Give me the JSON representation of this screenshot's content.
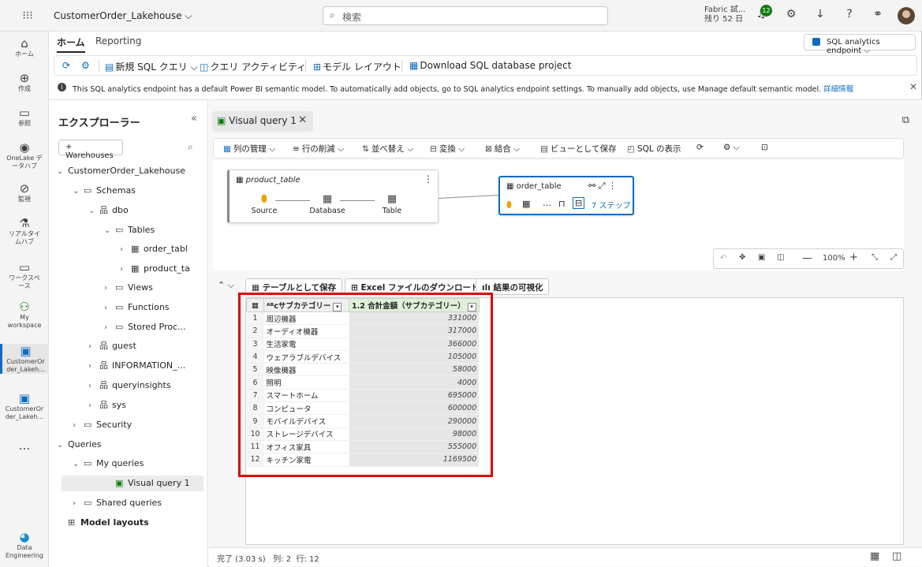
{
  "topbar": {
    "title": "CustomerOrder_Lakehouse",
    "search_placeholder": "検索",
    "trial_line1": "Fabric 試...",
    "trial_line2": "残り 52 日",
    "notifications_count": "12"
  },
  "rail": [
    {
      "label": "ホーム",
      "icon": "home-icon"
    },
    {
      "label": "作成",
      "icon": "plus-circle-icon"
    },
    {
      "label": "参照",
      "icon": "folder-icon"
    },
    {
      "label": "OneLake デ\nータハブ",
      "icon": "onelake-icon"
    },
    {
      "label": "監視",
      "icon": "monitor-icon"
    },
    {
      "label": "リアルタイ\nムハブ",
      "icon": "realtime-hub-icon"
    },
    {
      "label": "ワークスペ\nース",
      "icon": "workspaces-icon"
    },
    {
      "label": "My\nworkspace",
      "icon": "my-workspace-icon"
    },
    {
      "label": "CustomerOr\nder_Lakeh...",
      "icon": "lakehouse-icon"
    },
    {
      "label": "CustomerOr\nder_Lakeh...",
      "icon": "sql-endpoint-icon"
    },
    {
      "label": "...",
      "icon": "more-icon"
    },
    {
      "label": "Data\nEngineering",
      "icon": "data-engineering-icon"
    }
  ],
  "ribbon": {
    "tabs": [
      "ホーム",
      "Reporting"
    ],
    "endpoint_label": "SQL analytics endpoint",
    "new_sql_query": "新規 SQL クエリ",
    "query_activity": "クエリ アクティビティ",
    "model_layout": "モデル レイアウト",
    "download_project": "Download SQL database project"
  },
  "info": {
    "text": "This SQL analytics endpoint has a default Power BI semantic model. To automatically add objects, go to SQL analytics endpoint settings. To manually add objects, use Manage default semantic model.",
    "link": "詳細情報"
  },
  "explorer": {
    "title": "エクスプローラー",
    "warehouses_button": "Warehouses",
    "tree": [
      {
        "label": "CustomerOrder_Lakehouse",
        "depth": 0,
        "chev": "⌄",
        "icon": ""
      },
      {
        "label": "Schemas",
        "depth": 1,
        "chev": "⌄",
        "icon": "folder"
      },
      {
        "label": "dbo",
        "depth": 2,
        "chev": "⌄",
        "icon": "schema"
      },
      {
        "label": "Tables",
        "depth": 3,
        "chev": "⌄",
        "icon": "folder"
      },
      {
        "label": "order_tabl",
        "depth": 4,
        "chev": "›",
        "icon": "table"
      },
      {
        "label": "product_ta",
        "depth": 4,
        "chev": "›",
        "icon": "table"
      },
      {
        "label": "Views",
        "depth": 3,
        "chev": "›",
        "icon": "folder"
      },
      {
        "label": "Functions",
        "depth": 3,
        "chev": "›",
        "icon": "folder"
      },
      {
        "label": "Stored Proc...",
        "depth": 3,
        "chev": "›",
        "icon": "folder"
      },
      {
        "label": "guest",
        "depth": 2,
        "chev": "›",
        "icon": "schema"
      },
      {
        "label": "INFORMATION_...",
        "depth": 2,
        "chev": "›",
        "icon": "schema"
      },
      {
        "label": "queryinsights",
        "depth": 2,
        "chev": "›",
        "icon": "schema"
      },
      {
        "label": "sys",
        "depth": 2,
        "chev": "›",
        "icon": "schema"
      },
      {
        "label": "Security",
        "depth": 1,
        "chev": "›",
        "icon": "folder"
      },
      {
        "label": "Queries",
        "depth": 0,
        "chev": "⌄",
        "icon": ""
      },
      {
        "label": "My queries",
        "depth": 1,
        "chev": "⌄",
        "icon": "folder"
      },
      {
        "label": "Visual query 1",
        "depth": 3,
        "chev": "",
        "icon": "visual"
      },
      {
        "label": "Shared queries",
        "depth": 1,
        "chev": "›",
        "icon": "folder"
      },
      {
        "label": "Model layouts",
        "depth": 0,
        "chev": "",
        "icon": "model"
      }
    ]
  },
  "editor": {
    "tab_label": "Visual query 1",
    "toolbar": {
      "manage_columns": "列の管理",
      "remove_rows": "行の削減",
      "sort": "並べ替え",
      "transform": "変換",
      "combine": "結合",
      "save_as_view": "ビューとして保存",
      "view_sql": "SQL の表示"
    },
    "node1": {
      "title": "product_table",
      "steps": [
        "Source",
        "Database",
        "Table"
      ]
    },
    "node2": {
      "title": "order_table",
      "steps_label": "7 ステップ"
    },
    "zoom": "100%",
    "results": {
      "save_as_table": "テーブルとして保存",
      "excel_download": "Excel ファイルのダウンロード",
      "visualize": "結果の可視化",
      "columns": [
        "サブカテゴリー",
        "1.2 合計金額（サブカテゴリー）"
      ],
      "rows": [
        [
          "1",
          "周辺機器",
          "331000"
        ],
        [
          "2",
          "オーディオ機器",
          "317000"
        ],
        [
          "3",
          "生活家電",
          "366000"
        ],
        [
          "4",
          "ウェアラブルデバイス",
          "105000"
        ],
        [
          "5",
          "映像機器",
          "58000"
        ],
        [
          "6",
          "照明",
          "4000"
        ],
        [
          "7",
          "スマートホーム",
          "695000"
        ],
        [
          "8",
          "コンピュータ",
          "600000"
        ],
        [
          "9",
          "モバイルデバイス",
          "290000"
        ],
        [
          "10",
          "ストレージデバイス",
          "98000"
        ],
        [
          "11",
          "オフィス家具",
          "555000"
        ],
        [
          "12",
          "キッチン家電",
          "1169500"
        ]
      ]
    },
    "status": {
      "done": "完了 (3.03 s)",
      "cols": "列: 2",
      "rows": "行: 12"
    }
  }
}
